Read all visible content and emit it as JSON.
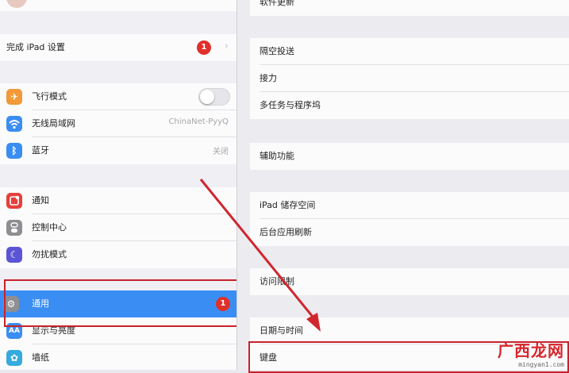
{
  "colors": {
    "selected_bg": "#3a8ef3",
    "badge_red": "#e0302a",
    "highlight_red": "#c8222b"
  },
  "sidebar": {
    "finish_setup": {
      "label": "完成 iPad 设置",
      "badge": "1"
    },
    "airplane": {
      "label": "飞行模式",
      "icon": "airplane-icon",
      "toggle_on": false
    },
    "wifi": {
      "label": "无线局域网",
      "value": "ChinaNet-PyyQ",
      "icon": "wifi-icon"
    },
    "bluetooth": {
      "label": "蓝牙",
      "value": "关闭",
      "icon": "bluetooth-icon"
    },
    "notifications": {
      "label": "通知",
      "icon": "notifications-icon"
    },
    "control_center": {
      "label": "控制中心",
      "icon": "control-center-icon"
    },
    "dnd": {
      "label": "勿扰模式",
      "icon": "moon-icon"
    },
    "general": {
      "label": "通用",
      "badge": "1",
      "icon": "gear-icon",
      "selected": true
    },
    "display": {
      "label": "显示与亮度",
      "icon": "display-aa-icon"
    },
    "wallpaper": {
      "label": "墙纸",
      "icon": "wallpaper-icon"
    }
  },
  "main": {
    "software_update": "软件更新",
    "airdrop": "隔空投送",
    "handoff": "接力",
    "multitasking": "多任务与程序坞",
    "accessibility": "辅助功能",
    "storage": "iPad 储存空间",
    "background_refresh": "后台应用刷新",
    "restrictions": "访问限制",
    "date_time": "日期与时间",
    "keyboard": "键盘"
  },
  "watermark": {
    "brand": "广西龙网",
    "url": "mingyan1.com"
  }
}
